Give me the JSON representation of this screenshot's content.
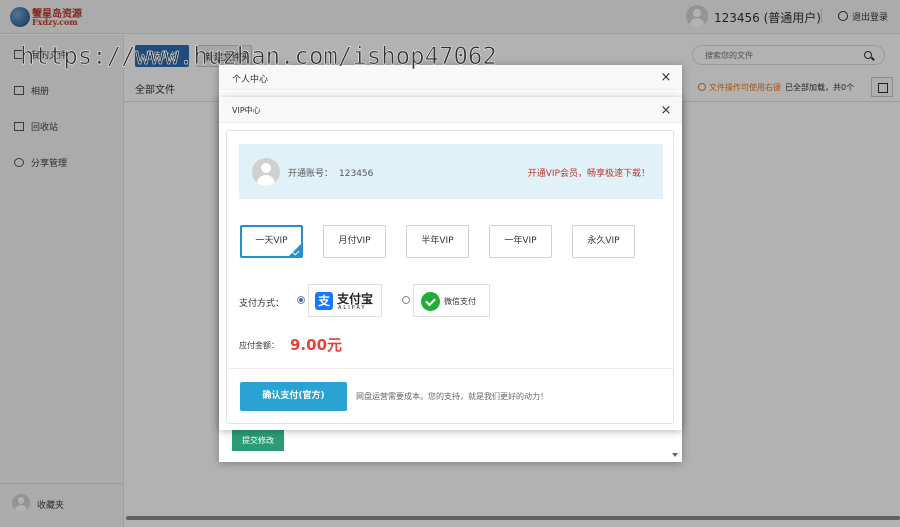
{
  "logo": {
    "line1": "蟹星岛资源",
    "line2": "Fxdzy.com"
  },
  "header": {
    "user": "123456 (普通用户)",
    "logout": "退出登录"
  },
  "sidebar": {
    "items": [
      {
        "label": "我的文件"
      },
      {
        "label": "相册"
      },
      {
        "label": "回收站"
      },
      {
        "label": "分享管理"
      }
    ],
    "favorites": "收藏夹"
  },
  "toolbar": {
    "upload": "上传文件",
    "new": "新建文件夹"
  },
  "search": {
    "placeholder": "搜索您的文件"
  },
  "breadcrumb": "全部文件",
  "info": {
    "tip": "文件操作可使用右键",
    "loaded": "已全部加载，共0个"
  },
  "watermark": "https://www.huzhan.com/ishop47062",
  "dialog_profile": {
    "title": "个人中心",
    "submit": "提交修改"
  },
  "dialog_vip": {
    "title": "VIP中心",
    "account_label": "开通账号：",
    "account_id": "123456",
    "promo": "开通VIP会员，畅享极速下载！",
    "plans": [
      {
        "label": "一天VIP",
        "selected": true
      },
      {
        "label": "月付VIP",
        "selected": false
      },
      {
        "label": "半年VIP",
        "selected": false
      },
      {
        "label": "一年VIP",
        "selected": false
      },
      {
        "label": "永久VIP",
        "selected": false
      }
    ],
    "payment_label": "支付方式：",
    "payment_options": [
      {
        "name": "支付宝",
        "sub": "ALIPAY",
        "icon": "alipay-icon",
        "color": "#1677ff",
        "selected": true
      },
      {
        "name": "微信支付",
        "icon": "wechat-pay-icon",
        "color": "#22ac38",
        "selected": false
      }
    ],
    "amount_label": "应付金额：",
    "amount": "9.00元",
    "confirm": "确认支付(官方)",
    "note": "网盘运营需要成本。您的支持，就是我们更好的动力！"
  },
  "colors": {
    "accent": "#2aa3d4",
    "price": "#e5413b",
    "promo": "#c0392b",
    "submit": "#2a9d78"
  }
}
